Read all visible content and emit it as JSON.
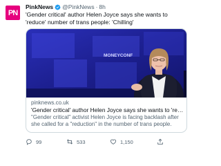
{
  "tweet": {
    "avatar_text": "PN",
    "author_name": "PinkNews",
    "handle": "@PinkNews",
    "separator": "·",
    "time": "8h",
    "text": "'Gender critical' author Helen Joyce says she wants to 'reduce' number of trans people: 'Chilling'"
  },
  "card": {
    "image_sign": "MONEYCONF",
    "domain": "pinknews.co.uk",
    "title": "'Gender critical' author Helen Joyce says she wants to 'reduce' number of trans pe...",
    "description": "\"Gender critical\" activist Helen Joyce is facing backlash after she called for a \"reduction\" in the number of trans people."
  },
  "actions": {
    "replies": "99",
    "retweets": "533",
    "likes": "1,150"
  },
  "colors": {
    "brand": "#e6007e",
    "verified": "#1d9bf0",
    "muted": "#536471"
  }
}
